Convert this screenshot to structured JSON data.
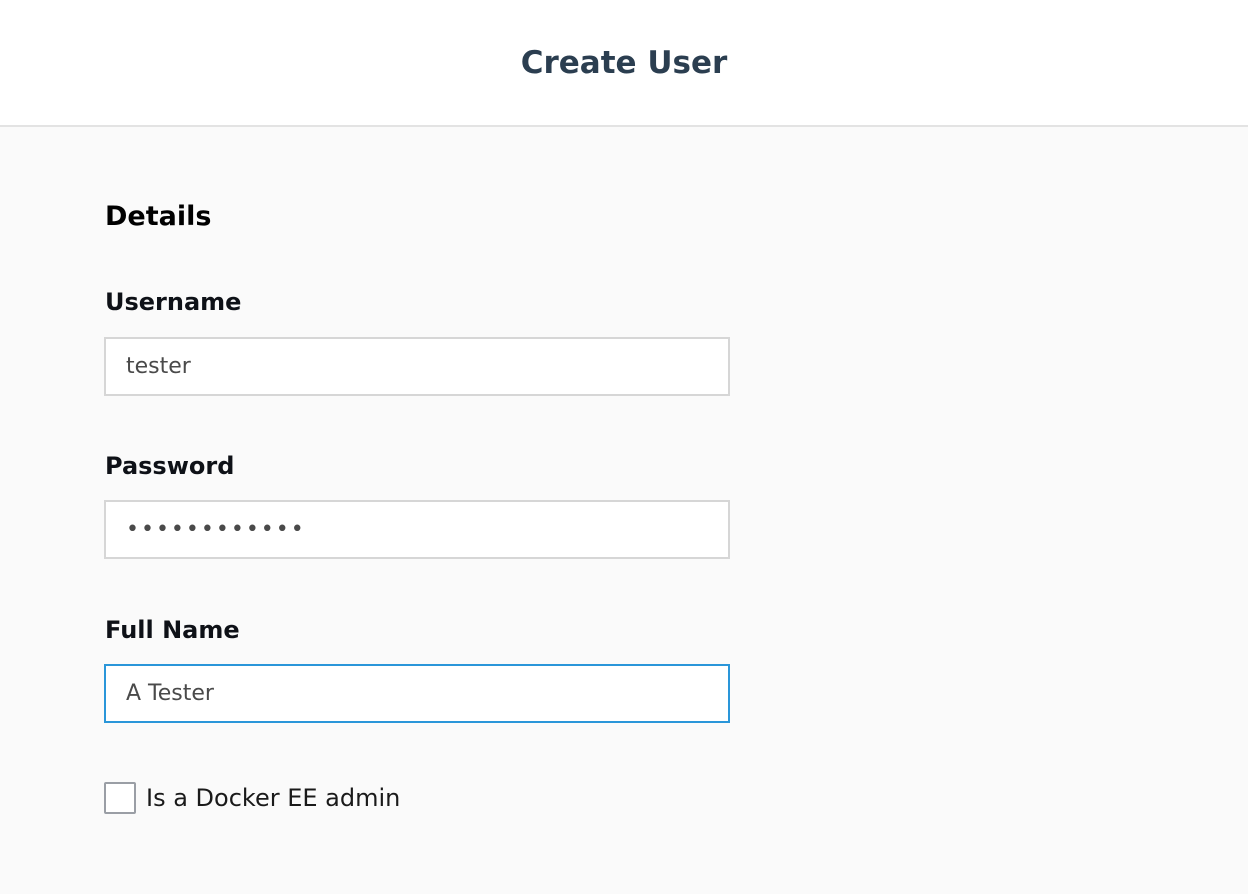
{
  "header": {
    "title": "Create User"
  },
  "form": {
    "section_title": "Details",
    "username": {
      "label": "Username",
      "value": "tester"
    },
    "password": {
      "label": "Password",
      "value": "testpassword"
    },
    "full_name": {
      "label": "Full Name",
      "value": "A Tester"
    },
    "admin_checkbox": {
      "label": "Is a Docker EE admin",
      "checked": false
    }
  },
  "colors": {
    "title": "#2b3e50",
    "focus_border": "#2a96d9",
    "input_border": "#d6d6d6",
    "background": "#fafafa"
  }
}
